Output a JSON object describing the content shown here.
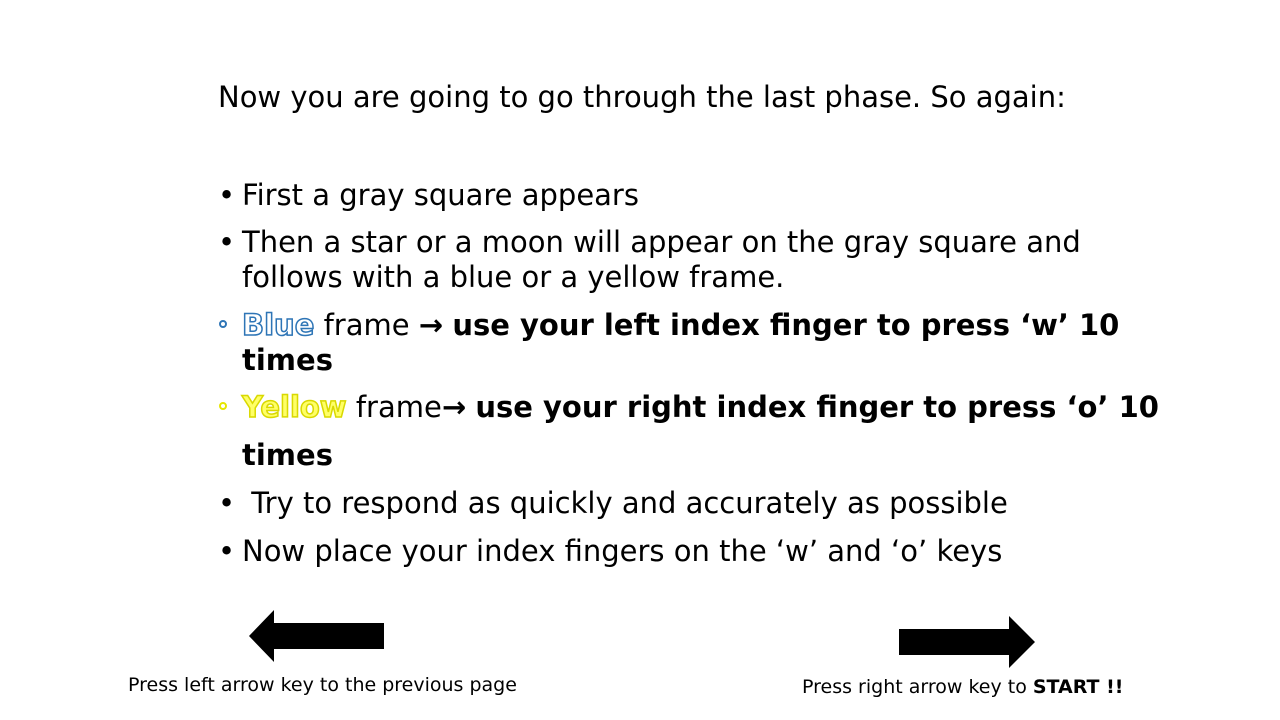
{
  "intro": "Now you are going to go through the last phase. So again:",
  "bullets": {
    "b1": "First a gray square appears",
    "b2_line1": "Then a star or a moon will appear on the gray square and",
    "b2_line2": "follows with a blue or a yellow frame.",
    "blue_word": "Blue",
    "blue_frame": " frame ",
    "blue_instruction": "use your left index finger to press ‘w’ 10",
    "blue_times": "times",
    "yellow_word": "Yellow",
    "yellow_frame": " frame",
    "yellow_instruction": "use your right index finger to press ‘o’ 10",
    "yellow_times": "times",
    "b5": " Try to respond as quickly and accurately as possible",
    "b6": "Now place your index fingers on the ‘w’ and ‘o’ keys"
  },
  "nav": {
    "left_label": "Press left arrow key to the previous page",
    "right_label_prefix": "Press right arrow key to ",
    "right_label_bold": "START !!"
  },
  "colors": {
    "blue": "#2e75b6",
    "yellow": "#ffff66"
  }
}
